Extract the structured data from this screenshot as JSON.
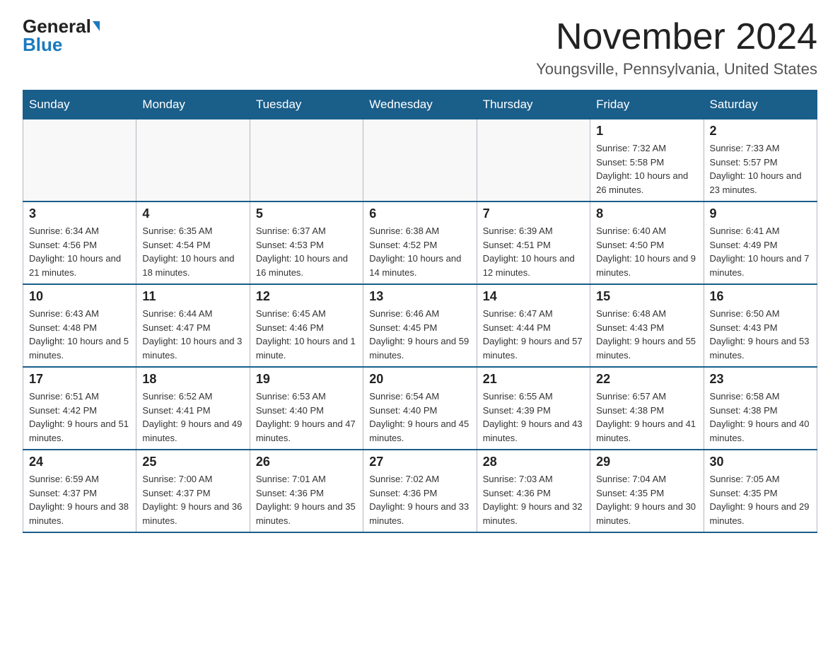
{
  "logo": {
    "general": "General",
    "blue": "Blue"
  },
  "header": {
    "month_year": "November 2024",
    "location": "Youngsville, Pennsylvania, United States"
  },
  "weekdays": [
    "Sunday",
    "Monday",
    "Tuesday",
    "Wednesday",
    "Thursday",
    "Friday",
    "Saturday"
  ],
  "weeks": [
    [
      {
        "day": "",
        "info": ""
      },
      {
        "day": "",
        "info": ""
      },
      {
        "day": "",
        "info": ""
      },
      {
        "day": "",
        "info": ""
      },
      {
        "day": "",
        "info": ""
      },
      {
        "day": "1",
        "info": "Sunrise: 7:32 AM\nSunset: 5:58 PM\nDaylight: 10 hours and 26 minutes."
      },
      {
        "day": "2",
        "info": "Sunrise: 7:33 AM\nSunset: 5:57 PM\nDaylight: 10 hours and 23 minutes."
      }
    ],
    [
      {
        "day": "3",
        "info": "Sunrise: 6:34 AM\nSunset: 4:56 PM\nDaylight: 10 hours and 21 minutes."
      },
      {
        "day": "4",
        "info": "Sunrise: 6:35 AM\nSunset: 4:54 PM\nDaylight: 10 hours and 18 minutes."
      },
      {
        "day": "5",
        "info": "Sunrise: 6:37 AM\nSunset: 4:53 PM\nDaylight: 10 hours and 16 minutes."
      },
      {
        "day": "6",
        "info": "Sunrise: 6:38 AM\nSunset: 4:52 PM\nDaylight: 10 hours and 14 minutes."
      },
      {
        "day": "7",
        "info": "Sunrise: 6:39 AM\nSunset: 4:51 PM\nDaylight: 10 hours and 12 minutes."
      },
      {
        "day": "8",
        "info": "Sunrise: 6:40 AM\nSunset: 4:50 PM\nDaylight: 10 hours and 9 minutes."
      },
      {
        "day": "9",
        "info": "Sunrise: 6:41 AM\nSunset: 4:49 PM\nDaylight: 10 hours and 7 minutes."
      }
    ],
    [
      {
        "day": "10",
        "info": "Sunrise: 6:43 AM\nSunset: 4:48 PM\nDaylight: 10 hours and 5 minutes."
      },
      {
        "day": "11",
        "info": "Sunrise: 6:44 AM\nSunset: 4:47 PM\nDaylight: 10 hours and 3 minutes."
      },
      {
        "day": "12",
        "info": "Sunrise: 6:45 AM\nSunset: 4:46 PM\nDaylight: 10 hours and 1 minute."
      },
      {
        "day": "13",
        "info": "Sunrise: 6:46 AM\nSunset: 4:45 PM\nDaylight: 9 hours and 59 minutes."
      },
      {
        "day": "14",
        "info": "Sunrise: 6:47 AM\nSunset: 4:44 PM\nDaylight: 9 hours and 57 minutes."
      },
      {
        "day": "15",
        "info": "Sunrise: 6:48 AM\nSunset: 4:43 PM\nDaylight: 9 hours and 55 minutes."
      },
      {
        "day": "16",
        "info": "Sunrise: 6:50 AM\nSunset: 4:43 PM\nDaylight: 9 hours and 53 minutes."
      }
    ],
    [
      {
        "day": "17",
        "info": "Sunrise: 6:51 AM\nSunset: 4:42 PM\nDaylight: 9 hours and 51 minutes."
      },
      {
        "day": "18",
        "info": "Sunrise: 6:52 AM\nSunset: 4:41 PM\nDaylight: 9 hours and 49 minutes."
      },
      {
        "day": "19",
        "info": "Sunrise: 6:53 AM\nSunset: 4:40 PM\nDaylight: 9 hours and 47 minutes."
      },
      {
        "day": "20",
        "info": "Sunrise: 6:54 AM\nSunset: 4:40 PM\nDaylight: 9 hours and 45 minutes."
      },
      {
        "day": "21",
        "info": "Sunrise: 6:55 AM\nSunset: 4:39 PM\nDaylight: 9 hours and 43 minutes."
      },
      {
        "day": "22",
        "info": "Sunrise: 6:57 AM\nSunset: 4:38 PM\nDaylight: 9 hours and 41 minutes."
      },
      {
        "day": "23",
        "info": "Sunrise: 6:58 AM\nSunset: 4:38 PM\nDaylight: 9 hours and 40 minutes."
      }
    ],
    [
      {
        "day": "24",
        "info": "Sunrise: 6:59 AM\nSunset: 4:37 PM\nDaylight: 9 hours and 38 minutes."
      },
      {
        "day": "25",
        "info": "Sunrise: 7:00 AM\nSunset: 4:37 PM\nDaylight: 9 hours and 36 minutes."
      },
      {
        "day": "26",
        "info": "Sunrise: 7:01 AM\nSunset: 4:36 PM\nDaylight: 9 hours and 35 minutes."
      },
      {
        "day": "27",
        "info": "Sunrise: 7:02 AM\nSunset: 4:36 PM\nDaylight: 9 hours and 33 minutes."
      },
      {
        "day": "28",
        "info": "Sunrise: 7:03 AM\nSunset: 4:36 PM\nDaylight: 9 hours and 32 minutes."
      },
      {
        "day": "29",
        "info": "Sunrise: 7:04 AM\nSunset: 4:35 PM\nDaylight: 9 hours and 30 minutes."
      },
      {
        "day": "30",
        "info": "Sunrise: 7:05 AM\nSunset: 4:35 PM\nDaylight: 9 hours and 29 minutes."
      }
    ]
  ]
}
